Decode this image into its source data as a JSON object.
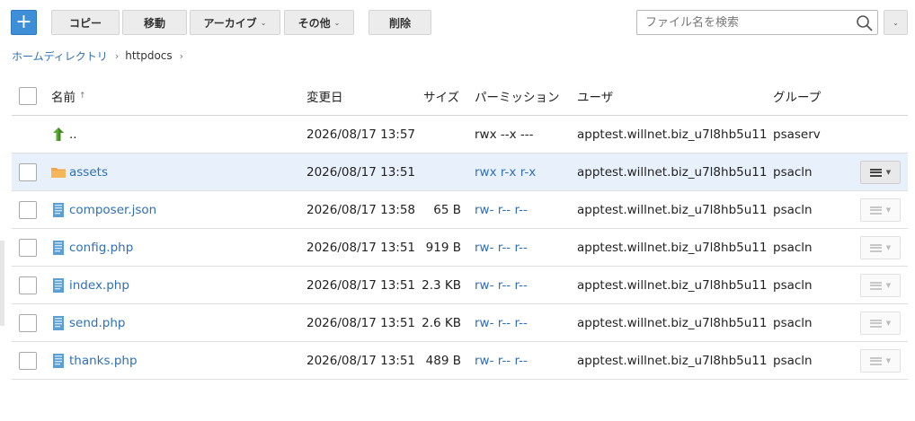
{
  "toolbar": {
    "add_label": "+",
    "copy_label": "コピー",
    "move_label": "移動",
    "archive_label": "アーカイブ",
    "other_label": "その他",
    "delete_label": "削除",
    "search_placeholder": "ファイル名を検索"
  },
  "breadcrumb": {
    "home": "ホームディレクトリ",
    "current": "httpdocs"
  },
  "columns": {
    "name": "名前",
    "modified": "変更日",
    "size": "サイズ",
    "permissions": "パーミッション",
    "user": "ユーザ",
    "group": "グループ"
  },
  "rows": [
    {
      "name": "..",
      "modified": "2026/08/17 13:57",
      "size": "",
      "permissions": "rwx --x ---",
      "user": "apptest.willnet.biz_u7l8hb5u11",
      "group": "psaserv",
      "type": "parent",
      "icon": "up-arrow-icon"
    },
    {
      "name": "assets",
      "modified": "2026/08/17 13:51",
      "size": "",
      "permissions": "rwx r-x r-x",
      "user": "apptest.willnet.biz_u7l8hb5u11",
      "group": "psacln",
      "type": "folder",
      "icon": "folder-icon"
    },
    {
      "name": "composer.json",
      "modified": "2026/08/17 13:58",
      "size": "65 B",
      "permissions": "rw- r-- r--",
      "user": "apptest.willnet.biz_u7l8hb5u11",
      "group": "psacln",
      "type": "file",
      "icon": "file-icon"
    },
    {
      "name": "config.php",
      "modified": "2026/08/17 13:51",
      "size": "919 B",
      "permissions": "rw- r-- r--",
      "user": "apptest.willnet.biz_u7l8hb5u11",
      "group": "psacln",
      "type": "file",
      "icon": "file-icon"
    },
    {
      "name": "index.php",
      "modified": "2026/08/17 13:51",
      "size": "2.3 KB",
      "permissions": "rw- r-- r--",
      "user": "apptest.willnet.biz_u7l8hb5u11",
      "group": "psacln",
      "type": "file",
      "icon": "file-icon"
    },
    {
      "name": "send.php",
      "modified": "2026/08/17 13:51",
      "size": "2.6 KB",
      "permissions": "rw- r-- r--",
      "user": "apptest.willnet.biz_u7l8hb5u11",
      "group": "psacln",
      "type": "file",
      "icon": "file-icon"
    },
    {
      "name": "thanks.php",
      "modified": "2026/08/17 13:51",
      "size": "489 B",
      "permissions": "rw- r-- r--",
      "user": "apptest.willnet.biz_u7l8hb5u11",
      "group": "psacln",
      "type": "file",
      "icon": "file-icon"
    }
  ],
  "colors": {
    "accent": "#3f8ed8",
    "link": "#2e6fb6",
    "selected_row": "#e8f1fb",
    "folder": "#f0a848",
    "up_arrow": "#5aa832",
    "file": "#5a9fd6"
  }
}
